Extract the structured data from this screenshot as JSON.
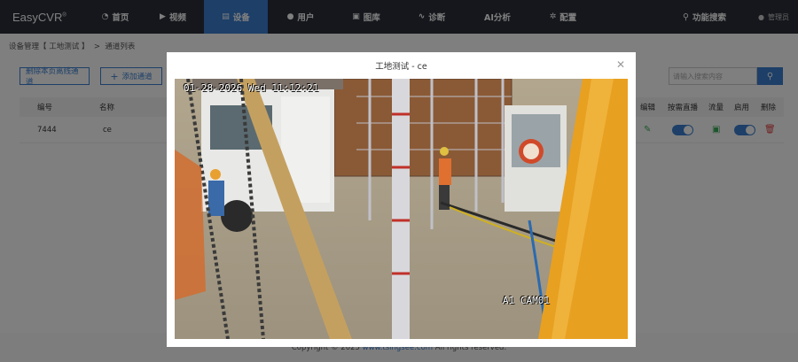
{
  "brand": {
    "name": "EasyCVR",
    "mark": "®"
  },
  "nav": {
    "items": [
      {
        "label": "首页",
        "icon": "dashboard-icon"
      },
      {
        "label": "视频",
        "icon": "play-icon"
      },
      {
        "label": "设备",
        "icon": "device-icon",
        "active": true
      },
      {
        "label": "用户",
        "icon": "user-icon"
      },
      {
        "label": "图库",
        "icon": "gallery-icon"
      },
      {
        "label": "诊断",
        "icon": "pulse-icon"
      },
      {
        "label": "AI分析",
        "icon": ""
      },
      {
        "label": "配置",
        "icon": "gear-icon"
      }
    ],
    "func_search": "功能搜索",
    "user": "管理员"
  },
  "breadcrumb": {
    "part1": "设备管理【 工地测试 】",
    "sep": ">",
    "part2": "通道列表"
  },
  "toolbar": {
    "delete_offline": "删除本页离线通道",
    "add_channel": "添加通道",
    "search_placeholder": "请输入搜索内容"
  },
  "table": {
    "headers": {
      "id": "编号",
      "name": "名称",
      "edit": "编辑",
      "ondemand": "按需直播",
      "flow": "流量",
      "enable": "启用",
      "delete": "删除"
    },
    "rows": [
      {
        "id": "7444",
        "name": "ce"
      }
    ]
  },
  "footer": {
    "prefix": "Copyright © 2025 ",
    "link": "www.tsingsee.com",
    "suffix": " All rights reserved."
  },
  "modal": {
    "title": "工地测试 - ce",
    "osd_time": "01-28-2026 Wed 11:12:21",
    "osd_cam": "A1  CAM01"
  },
  "colors": {
    "accent": "#3a7fd0",
    "nav_bg": "#2b2f38"
  }
}
